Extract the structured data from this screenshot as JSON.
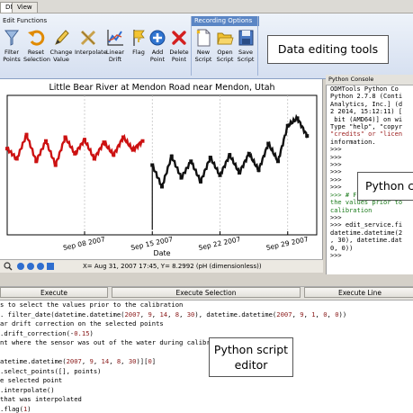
{
  "tabs": [
    "DM",
    "View"
  ],
  "ribbon": {
    "groups": {
      "edit_functions": "Edit Functions",
      "recording_options": "Recording Options"
    },
    "buttons": [
      {
        "id": "filter-points",
        "line1": "Filter",
        "line2": "Points"
      },
      {
        "id": "reset-selection",
        "line1": "Reset",
        "line2": "Selection"
      },
      {
        "id": "change-value",
        "line1": "Change",
        "line2": "Value"
      },
      {
        "id": "interpolate",
        "line1": "Interpolate",
        "line2": ""
      },
      {
        "id": "linear-drift",
        "line1": "Linear",
        "line2": "Drift"
      },
      {
        "id": "flag",
        "line1": "Flag",
        "line2": ""
      },
      {
        "id": "add-point",
        "line1": "Add",
        "line2": "Point"
      },
      {
        "id": "delete-point",
        "line1": "Delete",
        "line2": "Point"
      },
      {
        "id": "new-script",
        "line1": "New",
        "line2": "Script"
      },
      {
        "id": "open-script",
        "line1": "Open",
        "line2": "Script"
      },
      {
        "id": "save-script",
        "line1": "Save",
        "line2": "Script"
      }
    ]
  },
  "callouts": {
    "data_editing": "Data editing tools",
    "python_console": "Python co",
    "python_editor_line1": "Python script",
    "python_editor_line2": "editor"
  },
  "plot": {
    "status": "X= Aug 31, 2007 17:45,  Y= 8.2992 (pH (dimensionless))"
  },
  "chart_data": {
    "type": "scatter",
    "title": "Little Bear River at Mendon Road near Mendon, Utah",
    "xlabel": "Date",
    "ylabel": "",
    "x_tick_labels": [
      "Sep 08 2007",
      "Sep 15 2007",
      "Sep 22 2007",
      "Sep 29 2007"
    ],
    "xlim": [
      "2007-08-31",
      "2007-10-02"
    ],
    "ylim": [
      7.7,
      8.8
    ],
    "grid": true,
    "series": [
      {
        "color": "#cc1111",
        "x": [
          "2007-08-31",
          "2007-09-01",
          "2007-09-02",
          "2007-09-03",
          "2007-09-04",
          "2007-09-05",
          "2007-09-06",
          "2007-09-07",
          "2007-09-08",
          "2007-09-09",
          "2007-09-10",
          "2007-09-11",
          "2007-09-12",
          "2007-09-13",
          "2007-09-14"
        ],
        "y": [
          8.38,
          8.3,
          8.49,
          8.28,
          8.44,
          8.25,
          8.47,
          8.34,
          8.45,
          8.3,
          8.43,
          8.33,
          8.47,
          8.37,
          8.44
        ]
      },
      {
        "color": "#111111",
        "x": [
          "2007-09-15",
          "2007-09-16",
          "2007-09-17",
          "2007-09-18",
          "2007-09-19",
          "2007-09-20",
          "2007-09-21",
          "2007-09-22",
          "2007-09-23",
          "2007-09-24",
          "2007-09-25",
          "2007-09-26",
          "2007-09-27",
          "2007-09-28",
          "2007-09-29",
          "2007-09-30",
          "2007-10-01"
        ],
        "y": [
          8.25,
          8.08,
          8.32,
          8.15,
          8.28,
          8.12,
          8.31,
          8.17,
          8.33,
          8.19,
          8.34,
          8.21,
          8.42,
          8.28,
          8.56,
          8.62,
          8.48
        ]
      }
    ]
  },
  "console": {
    "title": "Python Console",
    "lines": [
      {
        "t": "ODMTools Python Co",
        "c": ""
      },
      {
        "t": "Python 2.7.8 (Conti",
        "c": ""
      },
      {
        "t": "Analytics, Inc.] (d",
        "c": ""
      },
      {
        "t": "2 2014, 15:12:11) [",
        "c": ""
      },
      {
        "t": " bit (AMD64)] on wi",
        "c": ""
      },
      {
        "t": "Type \"help\", \"copyr",
        "c": ""
      },
      {
        "t": "\"credits\" or \"licen",
        "c": "r"
      },
      {
        "t": "information.",
        "c": ""
      },
      {
        "t": ">>>",
        "c": ""
      },
      {
        "t": ">>>",
        "c": ""
      },
      {
        "t": ">>>",
        "c": ""
      },
      {
        "t": ">>>",
        "c": ""
      },
      {
        "t": ">>>",
        "c": ""
      },
      {
        "t": ">>>",
        "c": ""
      },
      {
        "t": ">>> # Filter the da",
        "c": "g"
      },
      {
        "t": "the values prior to",
        "c": "g"
      },
      {
        "t": "calibration",
        "c": "g"
      },
      {
        "t": ">>>",
        "c": ""
      },
      {
        "t": ">>> edit_service.fi",
        "c": ""
      },
      {
        "t": "datetime.datetime(2",
        "c": ""
      },
      {
        "t": ", 30), datetime.dat",
        "c": ""
      },
      {
        "t": "0, 0))",
        "c": ""
      },
      {
        "t": ">>>",
        "c": ""
      }
    ]
  },
  "exec": {
    "execute": "Execute",
    "execute_selection": "Execute Selection",
    "execute_line": "Execute Line"
  },
  "editor": {
    "lines": [
      "s to select the values prior to the calibration",
      ". filter_date(datetime.datetime(2007, 9, 14, 8, 30), datetime.datetime(2007, 9, 1, 0, 0))",
      "ar drift correction on the selected points",
      ".drift_correction(-0.15)",
      "nt where the sensor was out of the water during calibration",
      "",
      "atetime.datetime(2007, 9, 14, 8, 30)][0]",
      ".select_points([], points)",
      "e selected point",
      ".interpolate()",
      "that was interpolated",
      ".flag(1)"
    ]
  }
}
